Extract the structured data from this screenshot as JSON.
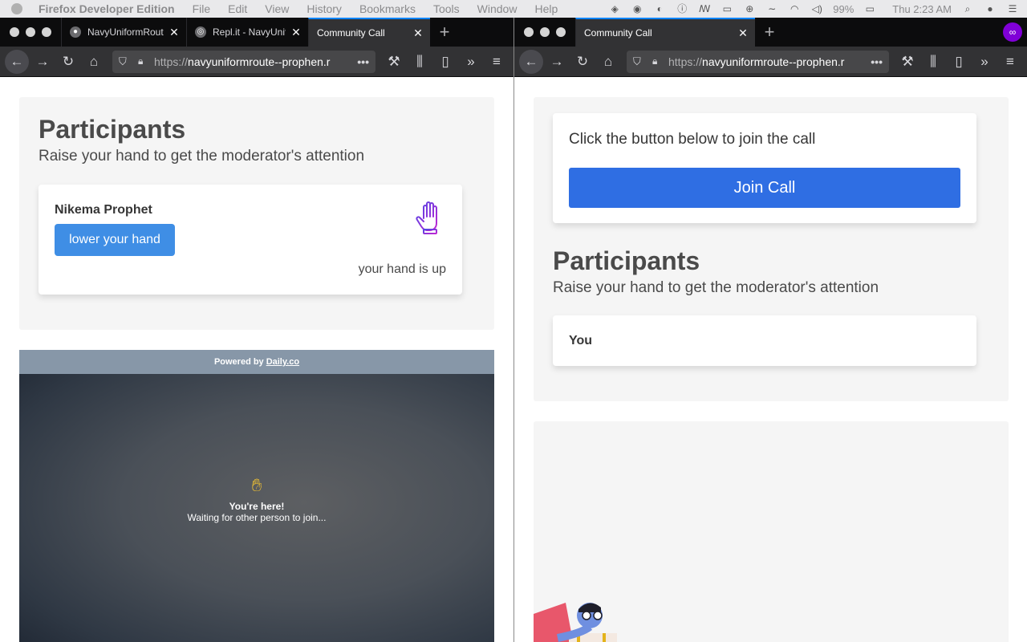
{
  "menubar": {
    "app_name": "Firefox Developer Edition",
    "items": [
      "File",
      "Edit",
      "View",
      "History",
      "Bookmarks",
      "Tools",
      "Window",
      "Help"
    ],
    "battery": "99%",
    "clock": "Thu 2:23 AM"
  },
  "left_window": {
    "tabs": [
      {
        "label": "NavyUniformRout"
      },
      {
        "label": "Repl.it - NavyUnif"
      },
      {
        "label": "Community Call"
      }
    ],
    "url_prefix": "https://",
    "url_host": "navyuniformroute--prophen.r",
    "participants_title": "Participants",
    "participants_subtitle": "Raise your hand to get the moderator's attention",
    "participant": {
      "name": "Nikema Prophet",
      "button_label": "lower your hand",
      "status": "your hand is up"
    },
    "video": {
      "powered_by": "Powered by",
      "powered_link": "Daily.co",
      "heading": "You're here!",
      "message": "Waiting for other person to join..."
    }
  },
  "right_window": {
    "tabs": [
      {
        "label": "Community Call"
      }
    ],
    "url_prefix": "https://",
    "url_host": "navyuniformroute--prophen.r",
    "join_prompt": "Click the button below to join the call",
    "join_button": "Join Call",
    "participants_title": "Participants",
    "participants_subtitle": "Raise your hand to get the moderator's attention",
    "participant": {
      "name": "You"
    }
  },
  "colors": {
    "accent_blue": "#3f8ee5",
    "join_blue": "#2f6ee3",
    "hand_purple": "#8a3ffc",
    "tab_active_indicator": "#0a84ff"
  }
}
